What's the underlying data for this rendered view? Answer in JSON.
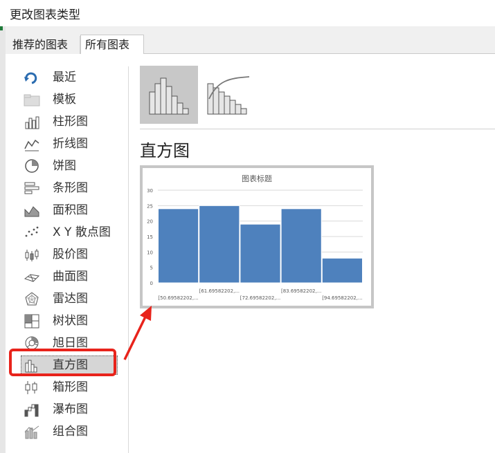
{
  "window": {
    "title": "更改图表类型"
  },
  "tabs": [
    {
      "label": "推荐的图表",
      "active": false
    },
    {
      "label": "所有图表",
      "active": true
    }
  ],
  "sidebar": {
    "items": [
      {
        "label": "最近",
        "icon": "recent-icon"
      },
      {
        "label": "模板",
        "icon": "folder-icon"
      },
      {
        "label": "柱形图",
        "icon": "column-chart-icon"
      },
      {
        "label": "折线图",
        "icon": "line-chart-icon"
      },
      {
        "label": "饼图",
        "icon": "pie-chart-icon"
      },
      {
        "label": "条形图",
        "icon": "bar-chart-icon"
      },
      {
        "label": "面积图",
        "icon": "area-chart-icon"
      },
      {
        "label": "X Y 散点图",
        "icon": "scatter-chart-icon"
      },
      {
        "label": "股价图",
        "icon": "stock-chart-icon"
      },
      {
        "label": "曲面图",
        "icon": "surface-chart-icon"
      },
      {
        "label": "雷达图",
        "icon": "radar-chart-icon"
      },
      {
        "label": "树状图",
        "icon": "treemap-chart-icon"
      },
      {
        "label": "旭日图",
        "icon": "sunburst-chart-icon"
      },
      {
        "label": "直方图",
        "icon": "histogram-chart-icon",
        "selected": true
      },
      {
        "label": "箱形图",
        "icon": "box-chart-icon"
      },
      {
        "label": "瀑布图",
        "icon": "waterfall-chart-icon"
      },
      {
        "label": "组合图",
        "icon": "combo-chart-icon"
      }
    ]
  },
  "main": {
    "subtypes": [
      {
        "icon": "histogram-subtype-icon",
        "selected": true
      },
      {
        "icon": "pareto-subtype-icon",
        "selected": false
      }
    ],
    "type_title": "直方图"
  },
  "colors": {
    "bar": "#4e81bd",
    "highlight": "#e8231b",
    "selected_bg": "#c8c8c8"
  },
  "chart_data": {
    "type": "bar",
    "title": "图表标题",
    "categories": [
      "[50.69582202,...",
      "[61.69582202,...",
      "[72.69582202,...",
      "[83.69582202,...",
      "[94.69582202,..."
    ],
    "values": [
      24,
      25,
      19,
      24,
      8
    ],
    "ylim": [
      0,
      30
    ],
    "yticks": [
      "0",
      "5",
      "10",
      "15",
      "20",
      "25",
      "30"
    ],
    "grid": true,
    "xlabel": "",
    "ylabel": ""
  }
}
